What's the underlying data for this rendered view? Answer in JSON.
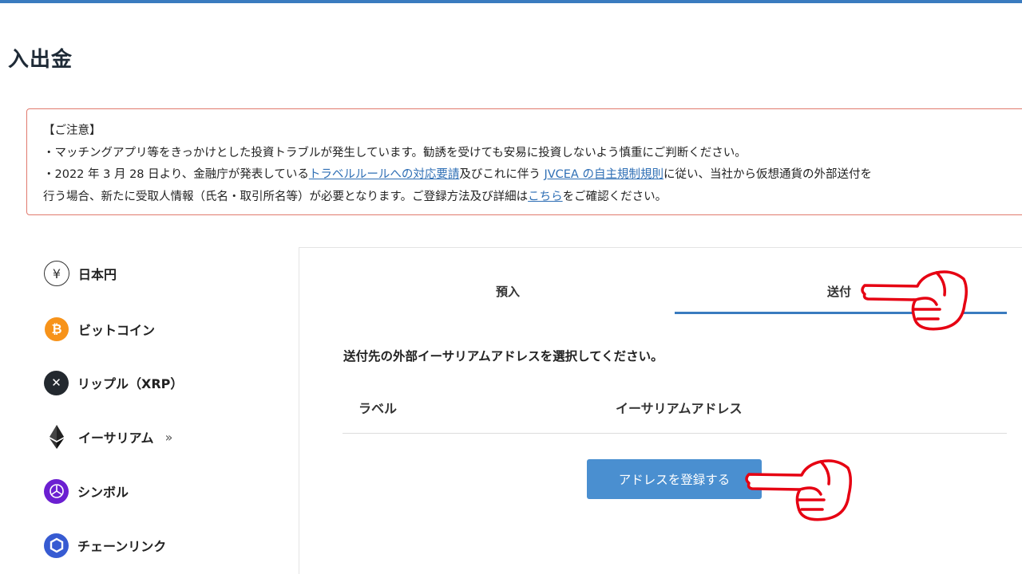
{
  "page": {
    "title": "入出金"
  },
  "notice": {
    "heading": "【ご注意】",
    "line1": "・マッチングアプリ等をきっかけとした投資トラブルが発生しています。勧誘を受けても安易に投資しないよう慎重にご判断ください。",
    "line2_prefix": "・2022 年 3 月 28 日より、金融庁が発表している",
    "line2_link1": "トラベルルールへの対応要請",
    "line2_middle": "及びこれに伴う ",
    "line2_link2": "JVCEA の自主規制規則",
    "line2_suffix": "に従い、当社から仮想通貨の外部送付を",
    "line3_prefix": "行う場合、新たに受取人情報（氏名・取引所名等）が必要となります。ご登録方法及び詳細は",
    "line3_link": "こちら",
    "line3_suffix": "をご確認ください。"
  },
  "sidebar": {
    "items": [
      {
        "label": "日本円",
        "icon": "yen-icon",
        "glyph": "¥"
      },
      {
        "label": "ビットコイン",
        "icon": "bitcoin-icon",
        "glyph": "₿",
        "color": "#f7931a"
      },
      {
        "label": "リップル（XRP）",
        "icon": "ripple-icon",
        "glyph": "✕",
        "color": "#23292f"
      },
      {
        "label": "イーサリアム",
        "icon": "ethereum-icon",
        "chevron": "»"
      },
      {
        "label": "シンボル",
        "icon": "symbol-icon",
        "color": "#6b1fd1"
      },
      {
        "label": "チェーンリンク",
        "icon": "chainlink-icon",
        "color": "#375bd2"
      }
    ]
  },
  "tabs": {
    "deposit": "預入",
    "send": "送付",
    "active": "send"
  },
  "main": {
    "instruction": "送付先の外部イーサリアムアドレスを選択してください。",
    "table": {
      "headers": [
        "ラベル",
        "イーサリアムアドレス"
      ]
    },
    "register_button": "アドレスを登録する"
  },
  "annotations": {
    "pointer_color": "#e60012"
  },
  "colors": {
    "accent": "#3a7bbf",
    "button": "#4a8fd0",
    "notice_border": "#e07a6e"
  }
}
